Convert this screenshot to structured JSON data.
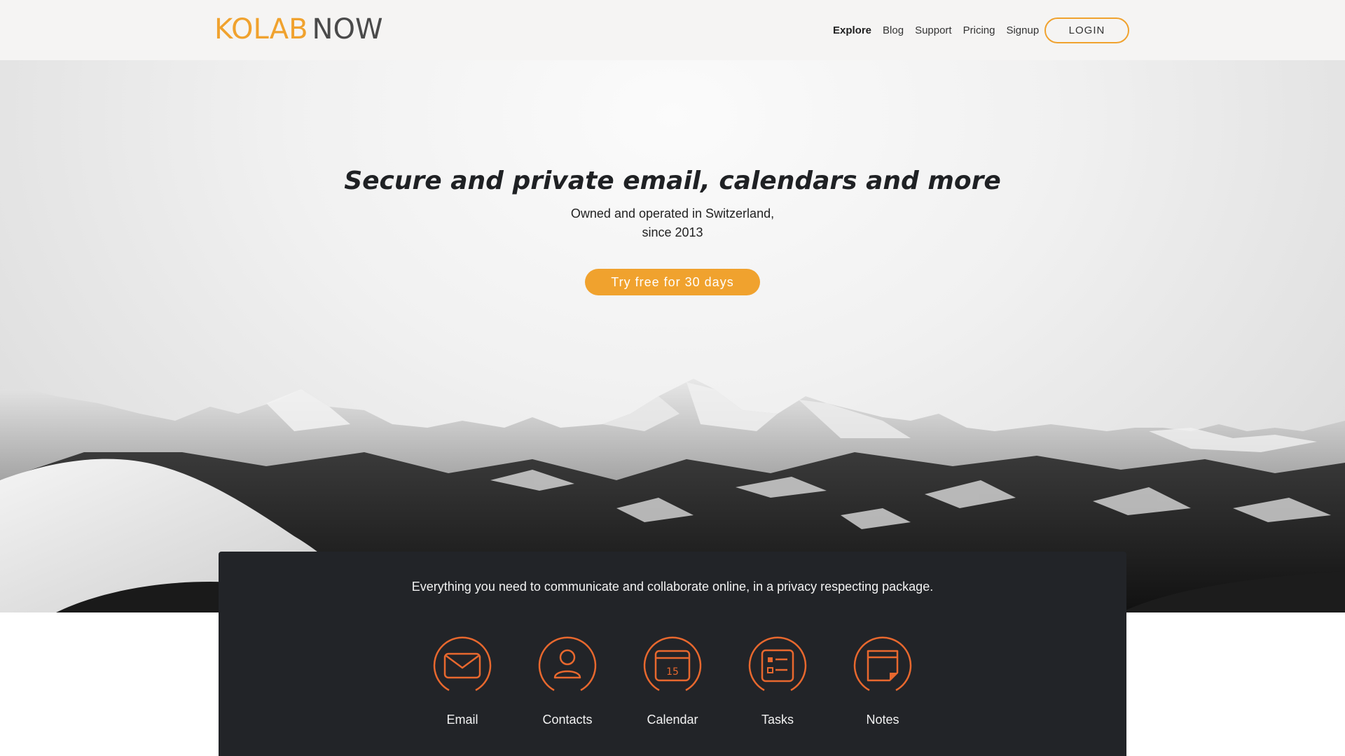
{
  "header": {
    "logo_part1": "KOLAB",
    "logo_part2": "NOW",
    "nav": [
      {
        "label": "Explore",
        "active": true
      },
      {
        "label": "Blog"
      },
      {
        "label": "Support"
      },
      {
        "label": "Pricing"
      },
      {
        "label": "Signup"
      }
    ],
    "login_label": "LOGIN"
  },
  "hero": {
    "title": "Secure and private email, calendars and more",
    "subtitle_line1": "Owned and operated in Switzerland,",
    "subtitle_line2": "since 2013",
    "cta_label": "Try free for 30 days"
  },
  "features": {
    "intro": "Everything you need to communicate and collaborate online, in a privacy respecting package.",
    "items": [
      {
        "label": "Email",
        "icon": "envelope-icon"
      },
      {
        "label": "Contacts",
        "icon": "person-icon"
      },
      {
        "label": "Calendar",
        "icon": "calendar-icon",
        "icon_text": "15"
      },
      {
        "label": "Tasks",
        "icon": "tasks-icon"
      },
      {
        "label": "Notes",
        "icon": "note-icon"
      }
    ]
  },
  "colors": {
    "brand_orange": "#f0a22e",
    "icon_orange": "#e8682e",
    "panel_dark": "#222428",
    "header_bg": "#f5f4f3"
  }
}
